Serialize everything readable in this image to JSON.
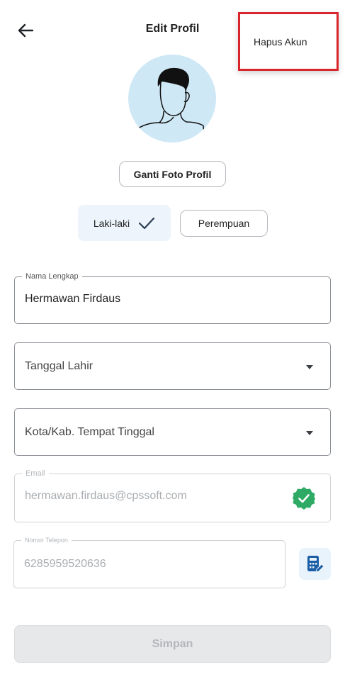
{
  "header": {
    "title": "Edit Profil",
    "back_icon": "arrow-left-icon"
  },
  "menu": {
    "delete_account_label": "Hapus Akun",
    "highlight_color": "#d9262c"
  },
  "profile": {
    "avatar_icon": "person-avatar-icon",
    "avatar_bg_color": "#cfe8f6",
    "change_photo_label": "Ganti Foto Profil"
  },
  "gender": {
    "male_label": "Laki-laki",
    "female_label": "Perempuan",
    "selected": "Laki-laki",
    "check_icon": "checkmark-icon"
  },
  "form": {
    "full_name": {
      "label": "Nama Lengkap",
      "value": "Hermawan Firdaus"
    },
    "birth_date": {
      "placeholder": "Tanggal Lahir"
    },
    "city": {
      "placeholder": "Kota/Kab. Tempat Tinggal"
    },
    "email": {
      "label": "Email",
      "value": "hermawan.firdaus@cpssoft.com",
      "verified_icon": "verified-badge-icon",
      "verified_color": "#2eaa64"
    },
    "phone": {
      "label": "Nomor Telepon",
      "value": "6285959520636",
      "edit_icon": "edit-phone-icon"
    }
  },
  "actions": {
    "save_label": "Simpan"
  }
}
